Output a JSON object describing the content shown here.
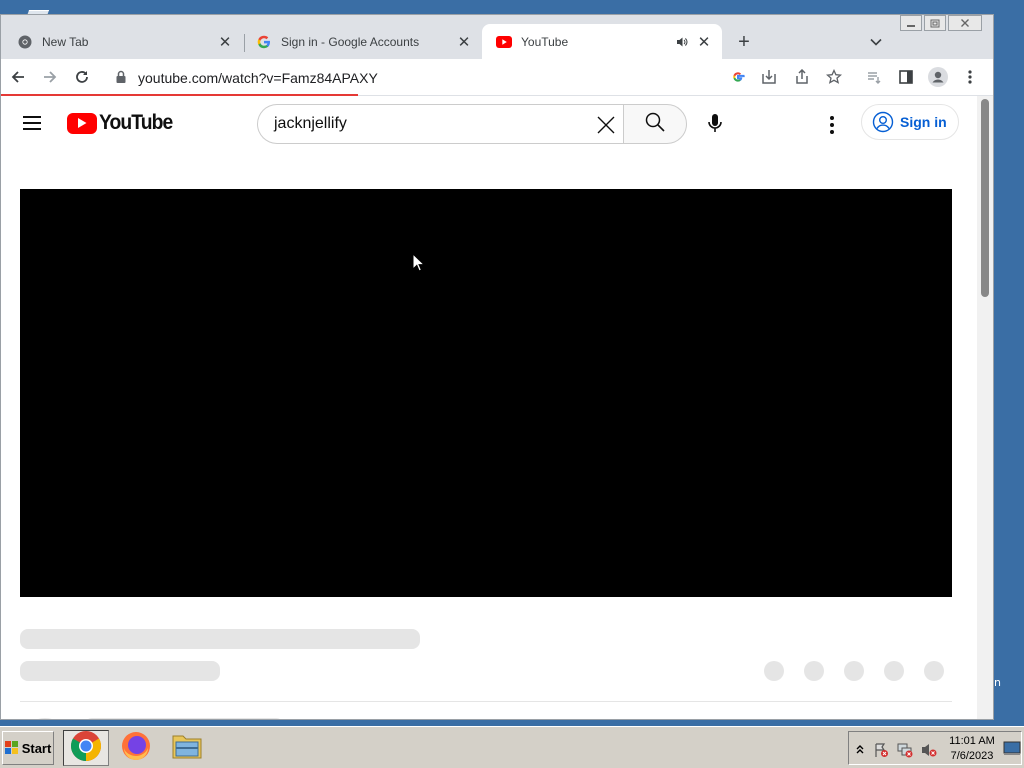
{
  "browser": {
    "tabs": [
      {
        "label": "New Tab",
        "icon": "chrome-icon",
        "active": false
      },
      {
        "label": "Sign in - Google Accounts",
        "icon": "google-g-icon",
        "active": false
      },
      {
        "label": "YouTube",
        "icon": "youtube-icon",
        "active": true,
        "audio": true
      }
    ],
    "url": "youtube.com/watch?v=Famz84APAXY",
    "new_tab": "+"
  },
  "youtube": {
    "logo_text": "YouTube",
    "search_query": "jacknjellify",
    "signin_label": "Sign in"
  },
  "taskbar": {
    "start_label": "Start",
    "time": "11:01 AM",
    "date": "7/6/2023"
  },
  "desktop": {
    "edge_fragment": "n"
  },
  "colors": {
    "youtube_red": "#ff0000",
    "link_blue": "#065fd4",
    "loading_bar": "#e53935",
    "desktop": "#3a6ea5"
  }
}
